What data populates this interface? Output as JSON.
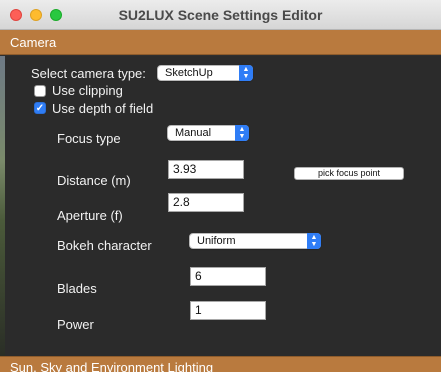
{
  "window": {
    "title": "SU2LUX Scene Settings Editor"
  },
  "sections": {
    "camera": "Camera",
    "sun": "Sun, Sky and Environment Lighting"
  },
  "camera": {
    "type_label": "Select camera type:",
    "type_value": "SketchUp",
    "use_clipping_label": "Use clipping",
    "use_clipping_checked": false,
    "use_dof_label": "Use depth of field",
    "use_dof_checked": true,
    "focus_type_label": "Focus type",
    "focus_type_value": "Manual",
    "distance_label": "Distance (m)",
    "distance_value": "3.93",
    "pick_focus_label": "pick focus point",
    "aperture_label": "Aperture (f)",
    "aperture_value": "2.8",
    "bokeh_label": "Bokeh character",
    "bokeh_value": "Uniform",
    "blades_label": "Blades",
    "blades_value": "6",
    "power_label": "Power",
    "power_value": "1"
  },
  "colors": {
    "section_header": "#b97a3e",
    "accent": "#2f7df6"
  }
}
